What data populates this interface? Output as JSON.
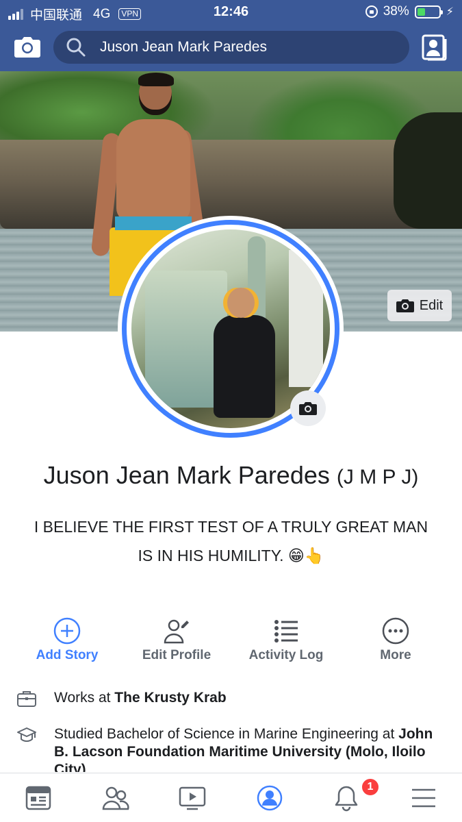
{
  "status_bar": {
    "carrier": "中国联通",
    "network": "4G",
    "vpn": "VPN",
    "time": "12:46",
    "battery_percent": "38%",
    "battery_level": 0.38
  },
  "header": {
    "search_text": "Juson Jean Mark Paredes",
    "accent_color": "#3b5998",
    "icons": [
      "camera-icon",
      "search-icon",
      "friends-profile-icon"
    ]
  },
  "cover": {
    "edit_label": "Edit"
  },
  "profile": {
    "name": "Juson Jean Mark Paredes",
    "alternate_name": "(J M P J)",
    "bio_line1": "I BELIEVE THE FIRST TEST OF A TRULY GREAT MAN",
    "bio_line2": "IS IN HIS HUMILITY. 😁👆",
    "ring_color": "#4080ff"
  },
  "actions": [
    {
      "label": "Add Story",
      "icon": "add-circle-icon"
    },
    {
      "label": "Edit Profile",
      "icon": "edit-person-icon"
    },
    {
      "label": "Activity Log",
      "icon": "list-icon"
    },
    {
      "label": "More",
      "icon": "more-icon"
    }
  ],
  "intro": {
    "work_prefix": "Works at ",
    "work_place": "The Krusty Krab",
    "edu_prefix": "Studied Bachelor of Science in Marine Engineering at ",
    "edu_school": "John B. Lacson Foundation Maritime University (Molo, Iloilo City)"
  },
  "tabbar": {
    "tabs": [
      "news-feed-icon",
      "friends-icon",
      "watch-icon",
      "profile-icon",
      "notifications-icon",
      "menu-icon"
    ],
    "active_tab": "profile-icon",
    "notification_count": "1"
  }
}
